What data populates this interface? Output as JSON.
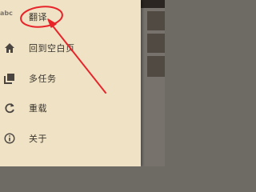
{
  "drawer": {
    "corner_text": "abc",
    "items": [
      {
        "label": "翻译",
        "icon": "translate-icon"
      },
      {
        "label": "回到空白页",
        "icon": "home-icon"
      },
      {
        "label": "多任务",
        "icon": "multitask-icon"
      },
      {
        "label": "重载",
        "icon": "reload-icon"
      },
      {
        "label": "关于",
        "icon": "info-icon"
      }
    ]
  },
  "colors": {
    "drawer_bg": "#efe2c5",
    "icon": "#4a4540",
    "text": "#3a352e",
    "annotation": "#e8242b"
  }
}
